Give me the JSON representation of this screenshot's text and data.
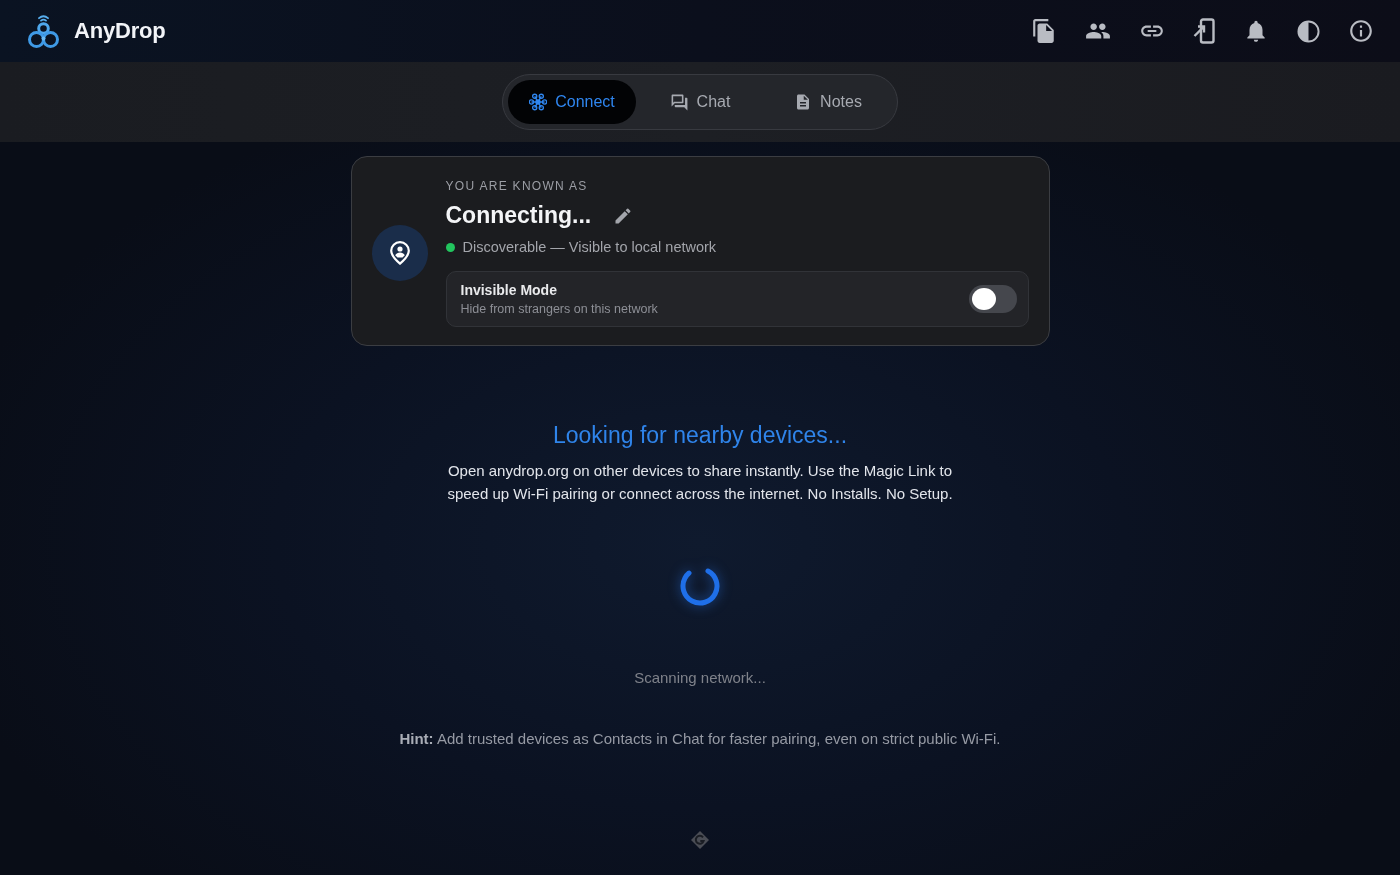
{
  "app": {
    "name": "AnyDrop"
  },
  "tabs": [
    {
      "label": "Connect",
      "selected": true
    },
    {
      "label": "Chat",
      "selected": false
    },
    {
      "label": "Notes",
      "selected": false
    }
  ],
  "identity": {
    "caption": "YOU ARE KNOWN AS",
    "name": "Connecting...",
    "discoverable": true,
    "status": "Discoverable — Visible to local network"
  },
  "invisible_mode": {
    "title": "Invisible Mode",
    "description": "Hide from strangers on this network",
    "on": false
  },
  "discovery": {
    "title": "Looking for nearby devices...",
    "body": "Open anydrop.org on other devices to share instantly. Use the Magic Link to speed up Wi-Fi pairing or connect across the internet. No Installs. No Setup.",
    "status": "Scanning network...",
    "hint": "**Hint:** Add trusted devices as Contacts in Chat for faster pairing, even on strict public Wi-Fi."
  }
}
